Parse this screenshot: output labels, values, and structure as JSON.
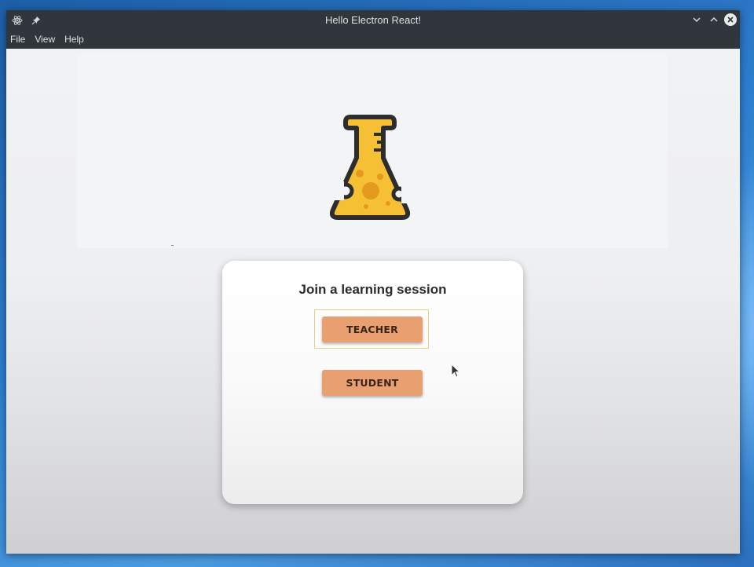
{
  "window": {
    "title": "Hello Electron React!"
  },
  "titlebar_icons": {
    "app_icon": "electron-atom-icon",
    "pin_icon": "pin-icon",
    "minimize_icon": "chevron-down-icon",
    "maximize_icon": "chevron-up-icon",
    "close_icon": "close-icon"
  },
  "menu": {
    "items": [
      "File",
      "View",
      "Help"
    ]
  },
  "logo": {
    "icon": "cheese-flask-icon",
    "colors": {
      "fill": "#f6c035",
      "outline": "#2d2d2d",
      "holes": "#e39a1e"
    }
  },
  "card": {
    "title": "Join a learning session",
    "buttons": {
      "teacher": "TEACHER",
      "student": "STUDENT"
    }
  },
  "colors": {
    "button_bg": "#e8a070",
    "focus_ring": "#e5cf83",
    "titlebar_bg": "#31363c",
    "desktop_accent": "#2f7fd0"
  }
}
